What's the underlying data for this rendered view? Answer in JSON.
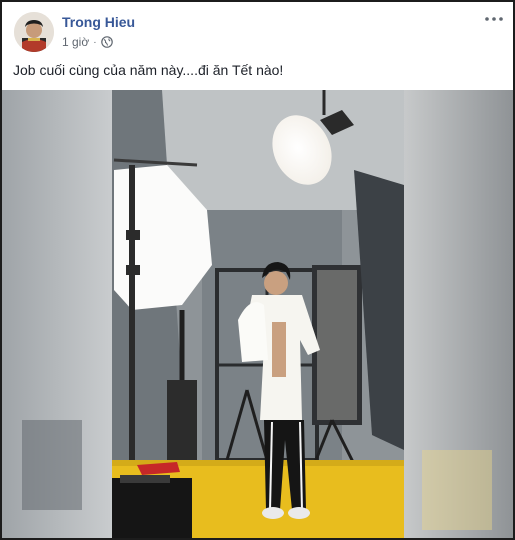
{
  "post": {
    "author": "Trong Hieu",
    "time": "1 giờ",
    "separator": "·",
    "privacy_icon": "globe-icon",
    "menu_icon": "more-options-icon",
    "text": "Job cuối cùng của năm này....đi ăn Tết nào!",
    "media": {
      "type": "video-still",
      "description": "studio photo shoot"
    }
  },
  "colors": {
    "author": "#385898",
    "meta": "#606770",
    "text": "#1d2129",
    "floor": "#e8bd1e"
  }
}
